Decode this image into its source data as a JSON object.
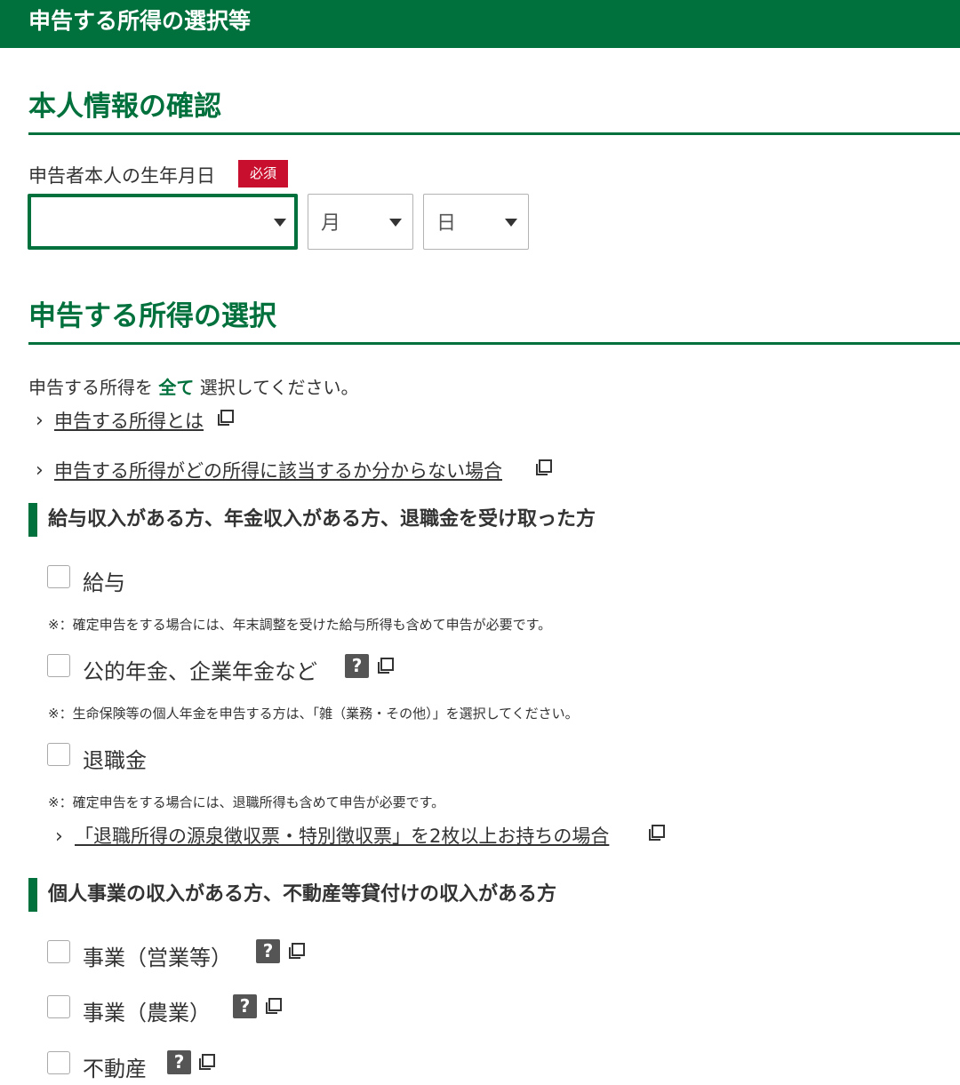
{
  "header": {
    "title": "申告する所得の選択等"
  },
  "personal": {
    "title": "本人情報の確認",
    "birth_label": "申告者本人の生年月日",
    "required": "必須",
    "year_value": "",
    "month_value": "月",
    "day_value": "日"
  },
  "income_select": {
    "title": "申告する所得の選択",
    "instruction_before": "申告する所得を",
    "instruction_emph": "全て",
    "instruction_after": "選択してください。",
    "links": [
      "申告する所得とは",
      "申告する所得がどの所得に該当するか分からない場合"
    ]
  },
  "group1": {
    "heading": "給与収入がある方、年金収入がある方、退職金を受け取った方",
    "items": [
      {
        "label": "給与",
        "note": "※：確定申告をする場合には、年末調整を受けた給与所得も含めて申告が必要です。"
      },
      {
        "label": "公的年金、企業年金など",
        "help": "?",
        "note": "※：生命保険等の個人年金を申告する方は、「雑（業務・その他）」を選択してください。"
      },
      {
        "label": "退職金",
        "note": "※：確定申告をする場合には、退職所得も含めて申告が必要です。"
      }
    ],
    "link": "「退職所得の源泉徴収票・特別徴収票」を2枚以上お持ちの場合"
  },
  "group2": {
    "heading": "個人事業の収入がある方、不動産等貸付けの収入がある方",
    "items": [
      {
        "label": "事業（営業等）",
        "help": "?"
      },
      {
        "label": "事業（農業）",
        "help": "?"
      },
      {
        "label": "不動産",
        "help": "?"
      }
    ]
  }
}
